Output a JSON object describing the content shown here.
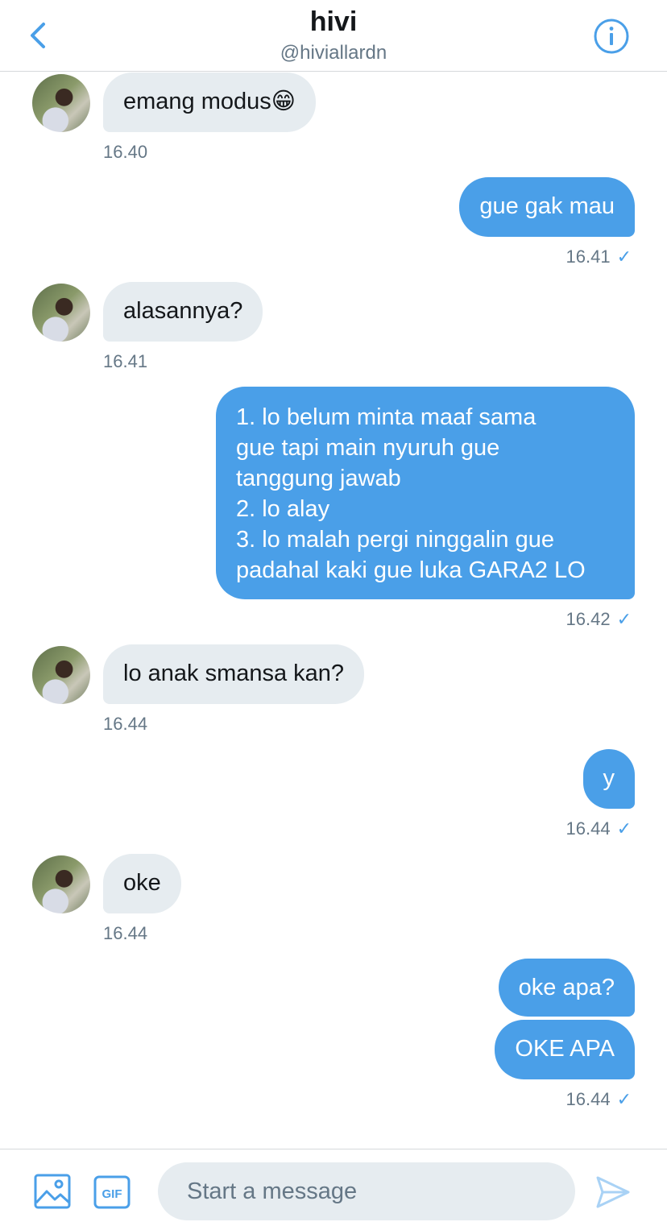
{
  "header": {
    "title": "hivi",
    "handle": "@hiviallardn"
  },
  "messages": [
    {
      "dir": "in",
      "text": "emang modus😁",
      "time": "16.40"
    },
    {
      "dir": "out",
      "text": "gue gak mau",
      "time": "16.41"
    },
    {
      "dir": "in",
      "text": "alasannya?",
      "time": "16.41"
    },
    {
      "dir": "out",
      "text": "1. lo belum minta maaf sama\ngue tapi main nyuruh gue\ntanggung jawab\n2. lo alay\n3. lo malah pergi ninggalin gue\npadahal kaki gue luka GARA2 LO",
      "time": "16.42"
    },
    {
      "dir": "in",
      "text": "lo anak smansa kan?",
      "time": "16.44"
    },
    {
      "dir": "out",
      "text": "y",
      "time": "16.44"
    },
    {
      "dir": "in",
      "text": "oke",
      "time": "16.44"
    },
    {
      "dir": "out",
      "text": "oke apa?",
      "time": ""
    },
    {
      "dir": "out",
      "text": "OKE APA",
      "time": "16.44"
    }
  ],
  "check_glyph": "✓",
  "composer": {
    "placeholder": "Start a message",
    "gif_label": "GIF"
  },
  "colors": {
    "accent": "#4a9fe8",
    "incoming_bubble": "#e6ecf0",
    "muted_text": "#657786"
  },
  "icons": [
    "back-chevron-icon",
    "info-icon",
    "image-icon",
    "gif-icon",
    "send-icon"
  ]
}
